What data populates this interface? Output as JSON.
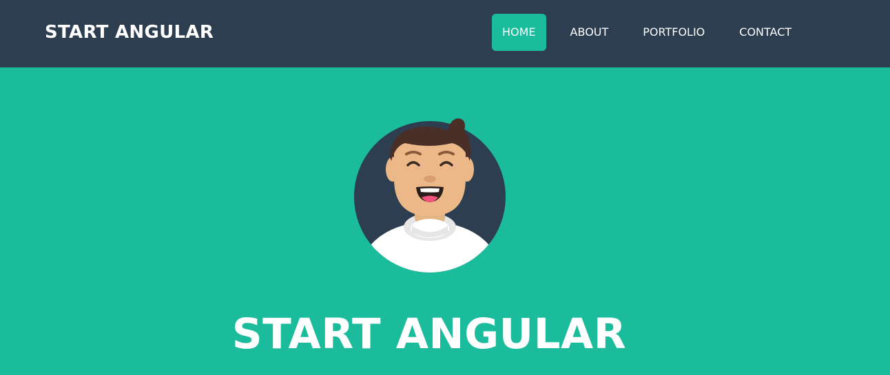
{
  "brand": {
    "label": "START ANGULAR"
  },
  "nav": {
    "items": [
      {
        "label": "HOME",
        "active": true
      },
      {
        "label": "ABOUT",
        "active": false
      },
      {
        "label": "PORTFOLIO",
        "active": false
      },
      {
        "label": "CONTACT",
        "active": false
      }
    ]
  },
  "hero": {
    "avatar_icon": "smiling-man-avatar-icon",
    "title": "START ANGULAR"
  },
  "colors": {
    "navbar_bg": "#2c3e50",
    "accent": "#1abc9c",
    "text": "#ffffff"
  }
}
